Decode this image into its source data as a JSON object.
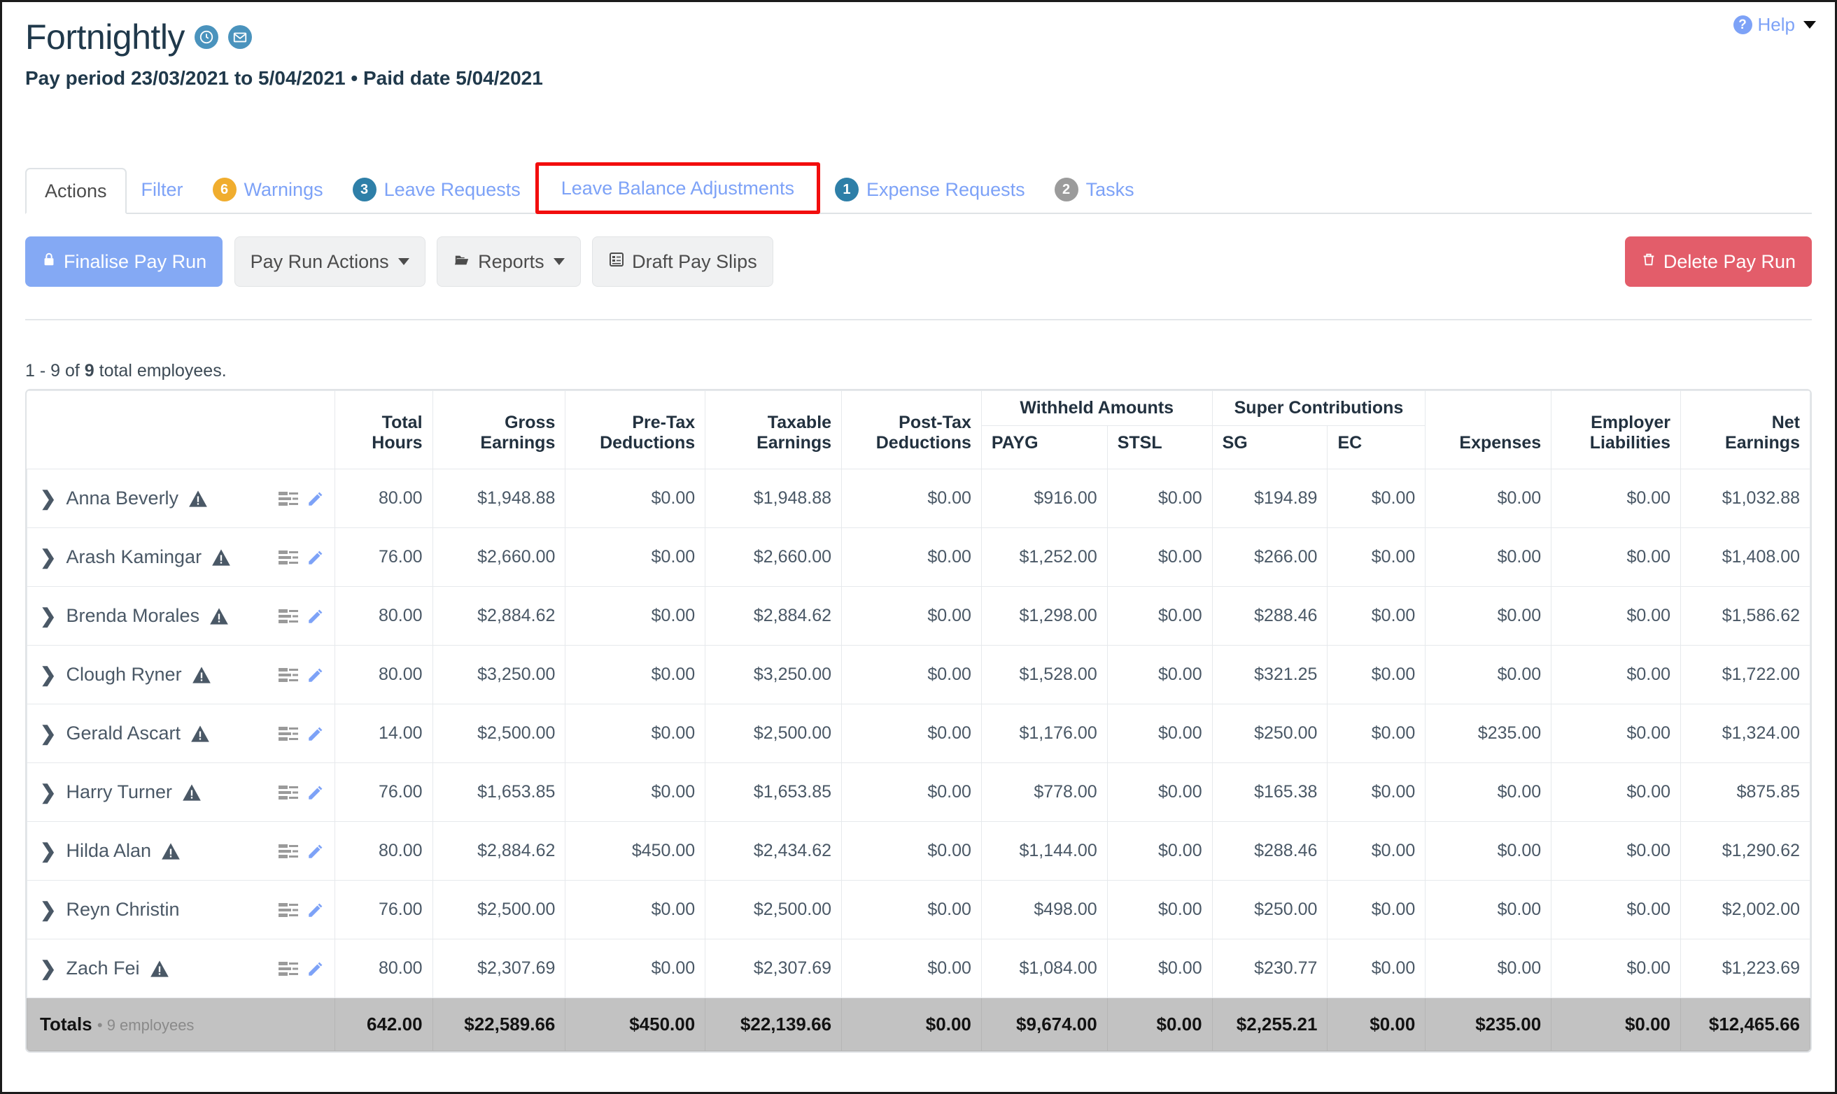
{
  "help": {
    "label": "Help",
    "icon": "question-mark-circle-icon",
    "caret": "chevron-down-icon"
  },
  "header": {
    "title": "Fortnightly",
    "subtitle": "Pay period 23/03/2021 to 5/04/2021 • Paid date 5/04/2021",
    "icons": [
      {
        "name": "clock-icon"
      },
      {
        "name": "envelope-icon"
      }
    ]
  },
  "tabs": [
    {
      "label": "Actions",
      "state": "active",
      "badge": null,
      "badge_type": null
    },
    {
      "label": "Filter",
      "state": "normal",
      "badge": null,
      "badge_type": null
    },
    {
      "label": "Warnings",
      "state": "normal",
      "badge": "6",
      "badge_type": "warning"
    },
    {
      "label": "Leave Requests",
      "state": "normal",
      "badge": "3",
      "badge_type": "info"
    },
    {
      "label": "Leave Balance Adjustments",
      "state": "highlighted",
      "badge": null,
      "badge_type": null
    },
    {
      "label": "Expense Requests",
      "state": "normal",
      "badge": "1",
      "badge_type": "info"
    },
    {
      "label": "Tasks",
      "state": "normal",
      "badge": "2",
      "badge_type": "muted"
    }
  ],
  "toolbar": {
    "finalise_label": "Finalise Pay Run",
    "finalise_icon": "lock-icon",
    "pay_run_actions_label": "Pay Run Actions",
    "reports_label": "Reports",
    "reports_icon": "folder-open-icon",
    "draft_pay_slips_label": "Draft Pay Slips",
    "draft_pay_slips_icon": "list-document-icon",
    "delete_label": "Delete Pay Run",
    "delete_icon": "trash-icon"
  },
  "count_prefix": "1 - 9 of ",
  "count_number": "9",
  "count_suffix": " total employees.",
  "table": {
    "group_headers": {
      "withheld": "Withheld Amounts",
      "super": "Super Contributions"
    },
    "columns": [
      "Total Hours",
      "Gross Earnings",
      "Pre-Tax Deductions",
      "Taxable Earnings",
      "Post-Tax Deductions",
      "PAYG",
      "STSL",
      "SG",
      "EC",
      "Expenses",
      "Employer Liabilities",
      "Net Earnings"
    ],
    "columns_line1": [
      "Total",
      "Gross",
      "Pre-Tax",
      "Taxable",
      "Post-Tax"
    ],
    "columns_line2": [
      "Hours",
      "Earnings",
      "Deductions",
      "Earnings",
      "Deductions"
    ],
    "sub_columns": [
      "PAYG",
      "STSL",
      "SG",
      "EC"
    ],
    "tail_columns_line1": [
      "",
      "Employer",
      "Net"
    ],
    "tail_columns_line2": [
      "Expenses",
      "Liabilities",
      "Earnings"
    ],
    "rows": [
      {
        "name": "Anna Beverly",
        "warning": true,
        "values": [
          "80.00",
          "$1,948.88",
          "$0.00",
          "$1,948.88",
          "$0.00",
          "$916.00",
          "$0.00",
          "$194.89",
          "$0.00",
          "$0.00",
          "$0.00",
          "$1,032.88"
        ]
      },
      {
        "name": "Arash Kamingar",
        "warning": true,
        "values": [
          "76.00",
          "$2,660.00",
          "$0.00",
          "$2,660.00",
          "$0.00",
          "$1,252.00",
          "$0.00",
          "$266.00",
          "$0.00",
          "$0.00",
          "$0.00",
          "$1,408.00"
        ]
      },
      {
        "name": "Brenda Morales",
        "warning": true,
        "values": [
          "80.00",
          "$2,884.62",
          "$0.00",
          "$2,884.62",
          "$0.00",
          "$1,298.00",
          "$0.00",
          "$288.46",
          "$0.00",
          "$0.00",
          "$0.00",
          "$1,586.62"
        ]
      },
      {
        "name": "Clough Ryner",
        "warning": true,
        "values": [
          "80.00",
          "$3,250.00",
          "$0.00",
          "$3,250.00",
          "$0.00",
          "$1,528.00",
          "$0.00",
          "$321.25",
          "$0.00",
          "$0.00",
          "$0.00",
          "$1,722.00"
        ]
      },
      {
        "name": "Gerald Ascart",
        "warning": true,
        "values": [
          "14.00",
          "$2,500.00",
          "$0.00",
          "$2,500.00",
          "$0.00",
          "$1,176.00",
          "$0.00",
          "$250.00",
          "$0.00",
          "$235.00",
          "$0.00",
          "$1,324.00"
        ]
      },
      {
        "name": "Harry Turner",
        "warning": true,
        "values": [
          "76.00",
          "$1,653.85",
          "$0.00",
          "$1,653.85",
          "$0.00",
          "$778.00",
          "$0.00",
          "$165.38",
          "$0.00",
          "$0.00",
          "$0.00",
          "$875.85"
        ]
      },
      {
        "name": "Hilda Alan",
        "warning": true,
        "values": [
          "80.00",
          "$2,884.62",
          "$450.00",
          "$2,434.62",
          "$0.00",
          "$1,144.00",
          "$0.00",
          "$288.46",
          "$0.00",
          "$0.00",
          "$0.00",
          "$1,290.62"
        ]
      },
      {
        "name": "Reyn Christin",
        "warning": false,
        "values": [
          "76.00",
          "$2,500.00",
          "$0.00",
          "$2,500.00",
          "$0.00",
          "$498.00",
          "$0.00",
          "$250.00",
          "$0.00",
          "$0.00",
          "$0.00",
          "$2,002.00"
        ]
      },
      {
        "name": "Zach Fei",
        "warning": true,
        "values": [
          "80.00",
          "$2,307.69",
          "$0.00",
          "$2,307.69",
          "$0.00",
          "$1,084.00",
          "$0.00",
          "$230.77",
          "$0.00",
          "$0.00",
          "$0.00",
          "$1,223.69"
        ]
      }
    ],
    "totals": {
      "label": "Totals",
      "sublabel": "• 9 employees",
      "values": [
        "642.00",
        "$22,589.66",
        "$450.00",
        "$22,139.66",
        "$0.00",
        "$9,674.00",
        "$0.00",
        "$2,255.21",
        "$0.00",
        "$235.00",
        "$0.00",
        "$12,465.66"
      ]
    }
  },
  "colors": {
    "primary": "#84a9f4",
    "danger": "#e35d6a",
    "link": "#7da2f7",
    "warning_badge": "#f0ad2e",
    "info_badge": "#2e7fa8",
    "muted_badge": "#9b9b9b",
    "highlight_border": "#f20d0d",
    "header_text": "#20394b",
    "totals_bg": "#c2c2c2"
  }
}
